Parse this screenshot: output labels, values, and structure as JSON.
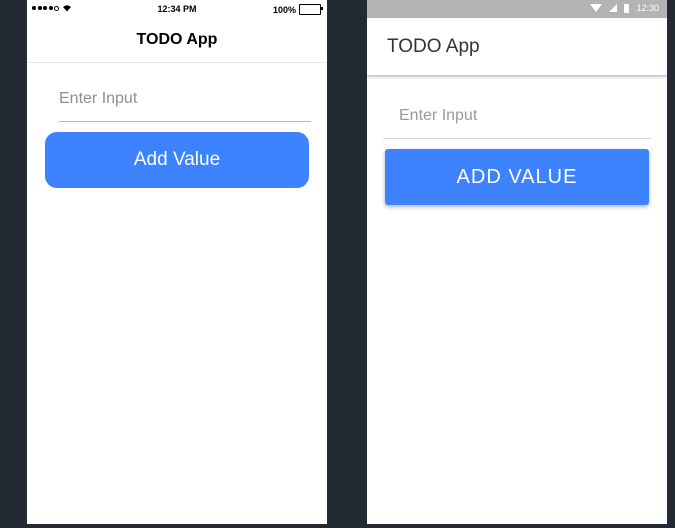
{
  "ios": {
    "status": {
      "time": "12:34 PM",
      "battery": "100%"
    },
    "nav_title": "TODO App",
    "input_placeholder": "Enter Input",
    "button_label": "Add Value"
  },
  "android": {
    "status": {
      "time": "12:30"
    },
    "toolbar_title": "TODO App",
    "input_placeholder": "Enter Input",
    "button_label": "ADD VALUE"
  },
  "colors": {
    "background": "#232a33",
    "accent": "#3d82ff",
    "android_status": "#b3b3b3"
  }
}
